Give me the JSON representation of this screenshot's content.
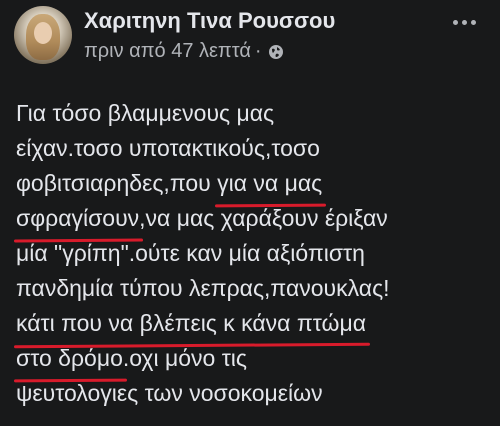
{
  "post": {
    "author": "Χαριτηνη Τινα Ρουσσου",
    "time": "πριν από 47 λεπτά",
    "separator": "·",
    "audience_icon": "globe-icon",
    "more_icon": "more-options-icon",
    "lines": [
      {
        "text": "Για τόσο βλαμμενους μας"
      },
      {
        "text": "είχαν.τοσο υποτακτικούς,τοσο"
      },
      {
        "pre": "φοβιτσιαρηδες,που ",
        "ul": "για να μας",
        "post": ""
      },
      {
        "pre": "",
        "ul": "σφραγίσουν",
        "post": ",να μας χαράξουν έριξαν"
      },
      {
        "text": "μία \"γρίπη\".ούτε καν μία αξιόπιστη"
      },
      {
        "text": "πανδημία τύπου λεπρας,πανουκλας!"
      },
      {
        "pre": "",
        "ul": "κάτι που να βλέπεις κ κάνα πτώμα",
        "post": ""
      },
      {
        "pre": "",
        "ul": "στο δρόμο",
        "post": ".οχι μόνο τις"
      },
      {
        "text": "ψευτολογιες των νοσοκομείων"
      }
    ]
  },
  "colors": {
    "background": "#18191a",
    "text": "#e4e6eb",
    "secondary_text": "#b0b3b8",
    "underline": "#d81b2b"
  }
}
